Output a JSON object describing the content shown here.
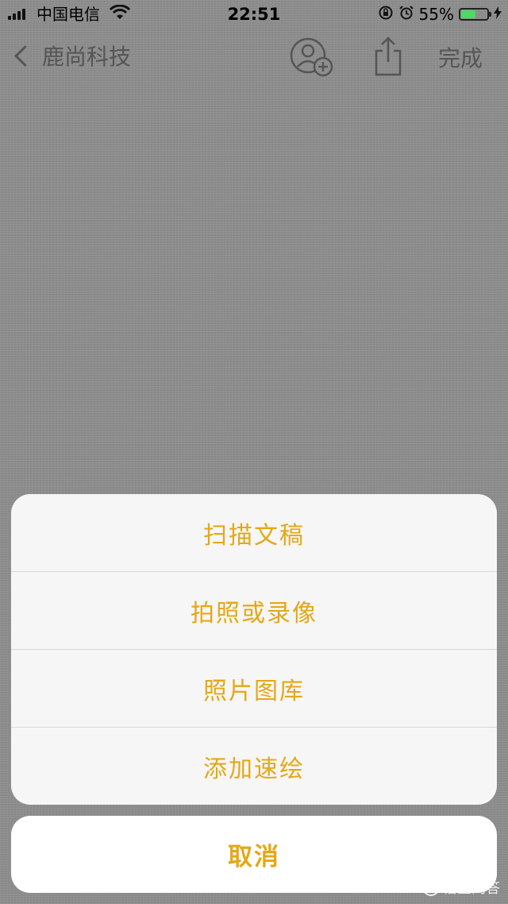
{
  "status_bar": {
    "carrier": "中国电信",
    "time": "22:51",
    "battery_percent": "55%",
    "battery_level": 0.55,
    "icons": [
      "signal-icon",
      "wifi-icon",
      "rotation-lock-icon",
      "alarm-icon",
      "battery-icon",
      "charging-icon"
    ]
  },
  "nav": {
    "back_label": "鹿尚科技",
    "done_label": "完成",
    "icons": [
      "back-chevron-icon",
      "add-person-icon",
      "share-icon"
    ]
  },
  "action_sheet": {
    "items": [
      {
        "label": "扫描文稿"
      },
      {
        "label": "拍照或录像"
      },
      {
        "label": "照片图库"
      },
      {
        "label": "添加速绘"
      }
    ],
    "cancel_label": "取消",
    "accent_color": "#e4a818"
  },
  "watermark": {
    "text": "悟空问答"
  }
}
